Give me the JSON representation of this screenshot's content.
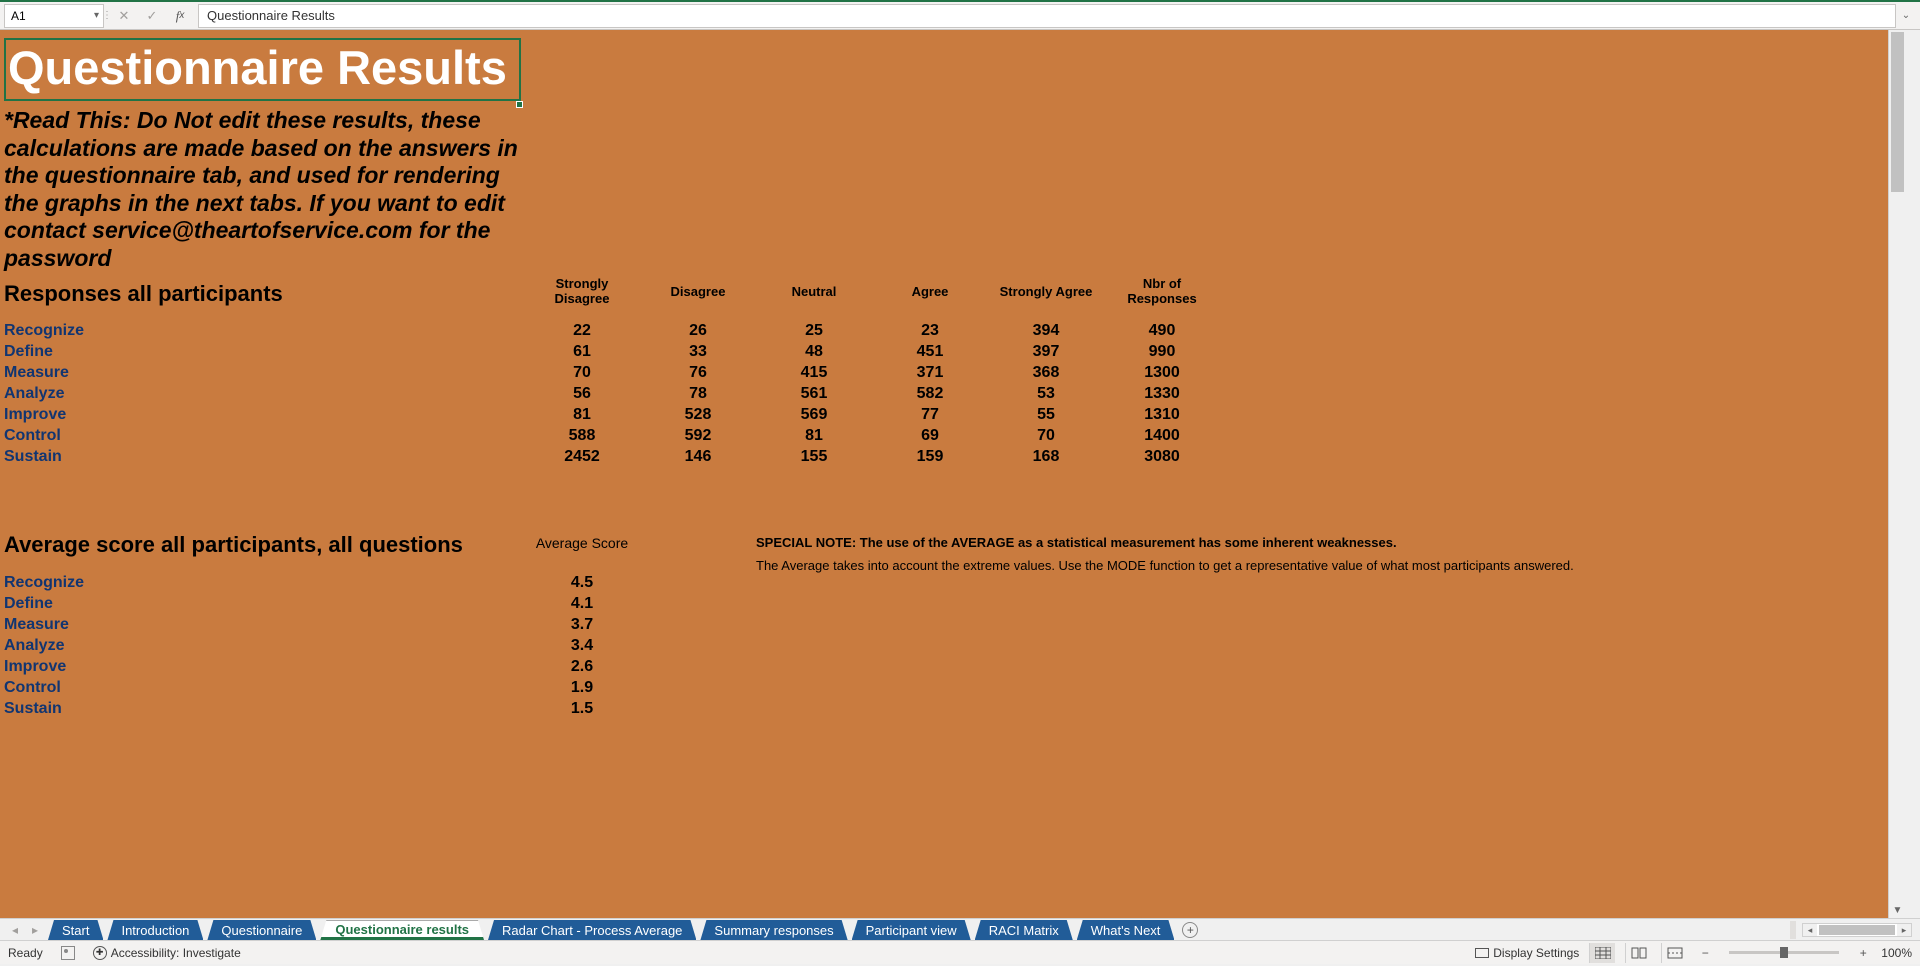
{
  "formula_bar": {
    "cell_ref": "A1",
    "formula_value": "Questionnaire Results"
  },
  "sheet": {
    "title": "Questionnaire Results",
    "note": "*Read This: Do Not edit these results, these calculations are made based on the answers in the questionnaire tab, and used for rendering the graphs in the next tabs. If you want to edit contact service@theartofservice.com for the password",
    "responses_header": "Responses all participants",
    "columns": {
      "strongly_disagree_l1": "Strongly",
      "strongly_disagree_l2": "Disagree",
      "disagree": "Disagree",
      "neutral": "Neutral",
      "agree": "Agree",
      "strongly_agree": "Strongly Agree",
      "nbr_l1": "Nbr of",
      "nbr_l2": "Responses"
    },
    "rows": [
      {
        "label": "Recognize",
        "sd": "22",
        "d": "26",
        "n": "25",
        "a": "23",
        "sa": "394",
        "nbr": "490"
      },
      {
        "label": "Define",
        "sd": "61",
        "d": "33",
        "n": "48",
        "a": "451",
        "sa": "397",
        "nbr": "990"
      },
      {
        "label": "Measure",
        "sd": "70",
        "d": "76",
        "n": "415",
        "a": "371",
        "sa": "368",
        "nbr": "1300"
      },
      {
        "label": "Analyze",
        "sd": "56",
        "d": "78",
        "n": "561",
        "a": "582",
        "sa": "53",
        "nbr": "1330"
      },
      {
        "label": "Improve",
        "sd": "81",
        "d": "528",
        "n": "569",
        "a": "77",
        "sa": "55",
        "nbr": "1310"
      },
      {
        "label": "Control",
        "sd": "588",
        "d": "592",
        "n": "81",
        "a": "69",
        "sa": "70",
        "nbr": "1400"
      },
      {
        "label": "Sustain",
        "sd": "2452",
        "d": "146",
        "n": "155",
        "a": "159",
        "sa": "168",
        "nbr": "3080"
      }
    ],
    "avg_header": "Average score all participants, all questions",
    "avg_col_label": "Average Score",
    "avg_rows": [
      {
        "label": "Recognize",
        "score": "4.5"
      },
      {
        "label": "Define",
        "score": "4.1"
      },
      {
        "label": "Measure",
        "score": "3.7"
      },
      {
        "label": "Analyze",
        "score": "3.4"
      },
      {
        "label": "Improve",
        "score": "2.6"
      },
      {
        "label": "Control",
        "score": "1.9"
      },
      {
        "label": "Sustain",
        "score": "1.5"
      }
    ],
    "special_note_bold": "SPECIAL NOTE: The use of the AVERAGE as a statistical measurement has some inherent weaknesses.",
    "special_note_text": "The Average takes into account the extreme values. Use the MODE function to get a representative value of what most participants answered."
  },
  "tabs": [
    {
      "label": "Start",
      "active": false
    },
    {
      "label": "Introduction",
      "active": false
    },
    {
      "label": "Questionnaire",
      "active": false
    },
    {
      "label": "Questionnaire results",
      "active": true
    },
    {
      "label": "Radar Chart - Process Average",
      "active": false
    },
    {
      "label": "Summary responses",
      "active": false
    },
    {
      "label": "Participant view",
      "active": false
    },
    {
      "label": "RACI Matrix",
      "active": false
    },
    {
      "label": "What's Next",
      "active": false
    }
  ],
  "status": {
    "ready": "Ready",
    "accessibility": "Accessibility: Investigate",
    "display_settings": "Display Settings",
    "zoom": "100%"
  }
}
